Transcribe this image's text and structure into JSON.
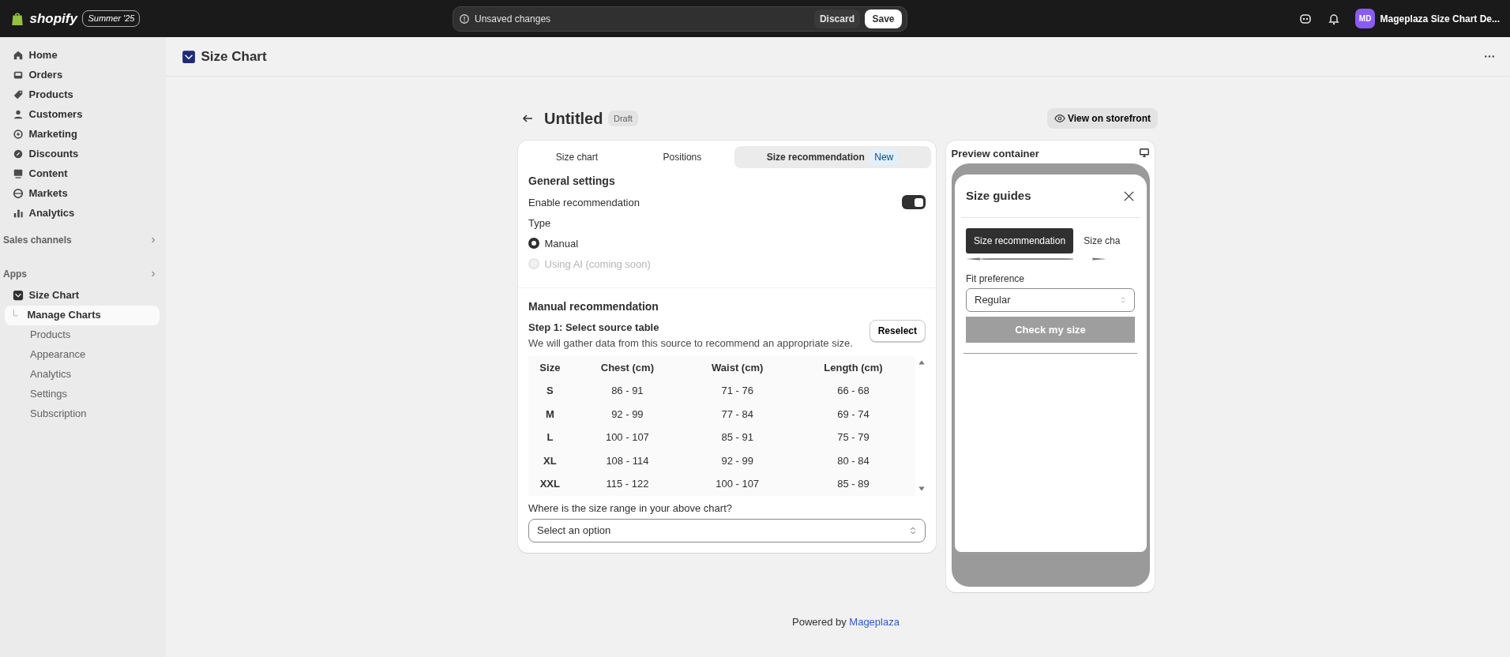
{
  "topbar": {
    "brand": "shopify",
    "edition": "Summer '25",
    "notice": "Unsaved changes",
    "discard": "Discard",
    "save": "Save",
    "avatar": "MD",
    "store": "Mageplaza Size Chart De..."
  },
  "sidebar": {
    "items": [
      {
        "label": "Home",
        "selected": false
      },
      {
        "label": "Orders",
        "selected": false
      },
      {
        "label": "Products",
        "selected": false
      },
      {
        "label": "Customers",
        "selected": false
      },
      {
        "label": "Marketing",
        "selected": false
      },
      {
        "label": "Discounts",
        "selected": false
      },
      {
        "label": "Content",
        "selected": false
      },
      {
        "label": "Markets",
        "selected": false
      },
      {
        "label": "Analytics",
        "selected": false
      }
    ],
    "sales_channels": "Sales channels",
    "apps": "Apps",
    "app_name": "Size Chart",
    "app_items": [
      {
        "label": "Manage Charts",
        "selected": true
      },
      {
        "label": "Products",
        "selected": false
      },
      {
        "label": "Appearance",
        "selected": false
      },
      {
        "label": "Analytics",
        "selected": false
      },
      {
        "label": "Settings",
        "selected": false
      },
      {
        "label": "Subscription",
        "selected": false
      }
    ]
  },
  "page_header": {
    "title": "Size Chart"
  },
  "editor": {
    "title": "Untitled",
    "status": "Draft",
    "view_button": "View on storefront",
    "tabs": [
      {
        "label": "Size chart",
        "selected": false
      },
      {
        "label": "Positions",
        "selected": false
      },
      {
        "label": "Size recommendation",
        "badge": "New",
        "selected": true
      }
    ],
    "general_heading": "General settings",
    "enable_label": "Enable recommendation",
    "enable_on": true,
    "type_label": "Type",
    "types": [
      {
        "label": "Manual",
        "selected": true,
        "disabled": false
      },
      {
        "label": "Using AI (coming soon)",
        "selected": false,
        "disabled": true
      }
    ],
    "manual_heading": "Manual recommendation",
    "step_title": "Step 1: Select source table",
    "step_desc": "We will gather data from this source to recommend an appropriate size.",
    "reselect": "Reselect",
    "table": {
      "columns": [
        "Size",
        "Chest (cm)",
        "Waist (cm)",
        "Length (cm)"
      ],
      "rows": [
        [
          "S",
          "86 - 91",
          "71 - 76",
          "66 - 68"
        ],
        [
          "M",
          "92 - 99",
          "77 - 84",
          "69 - 74"
        ],
        [
          "L",
          "100 - 107",
          "85 - 91",
          "75 - 79"
        ],
        [
          "XL",
          "108 - 114",
          "92 - 99",
          "80 - 84"
        ],
        [
          "XXL",
          "115 - 122",
          "100 - 107",
          "85 - 89"
        ]
      ]
    },
    "question": "Where is the size range in your above chart?",
    "select_placeholder": "Select an option"
  },
  "preview": {
    "title": "Preview container",
    "modal_title": "Size guides",
    "tabs": [
      {
        "label": "Size recommendation",
        "selected": true
      },
      {
        "label": "Size cha",
        "selected": false
      }
    ],
    "fit_label": "Fit preference",
    "fit_value": "Regular",
    "check_button": "Check my size",
    "check_disabled": true
  },
  "footer": {
    "text": "Powered by",
    "link": "Mageplaza"
  }
}
